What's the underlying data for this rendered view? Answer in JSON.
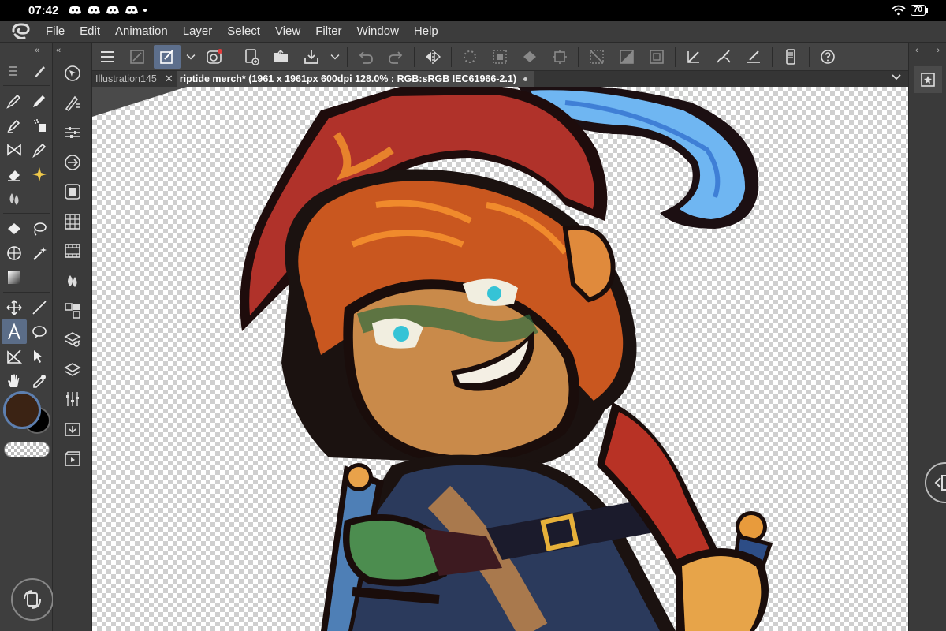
{
  "status_bar": {
    "time": "07:42",
    "battery": "70"
  },
  "menu": {
    "items": [
      "File",
      "Edit",
      "Animation",
      "Layer",
      "Select",
      "View",
      "Filter",
      "Window",
      "Help"
    ]
  },
  "tabs": [
    {
      "label": "Illustration145",
      "active": false
    },
    {
      "label": "riptide merch* (1961 x 1961px 600dpi 128.0% : RGB:sRGB IEC61966-2.1)",
      "active": true
    }
  ],
  "tool_palette": {
    "selected_tool": "text-tool"
  },
  "colors": {
    "main": "#3b2314",
    "sub": "#000000",
    "selection_accent": "#5b6d88"
  },
  "canvas": {
    "document_title": "riptide merch",
    "zoom": "128.0%"
  }
}
